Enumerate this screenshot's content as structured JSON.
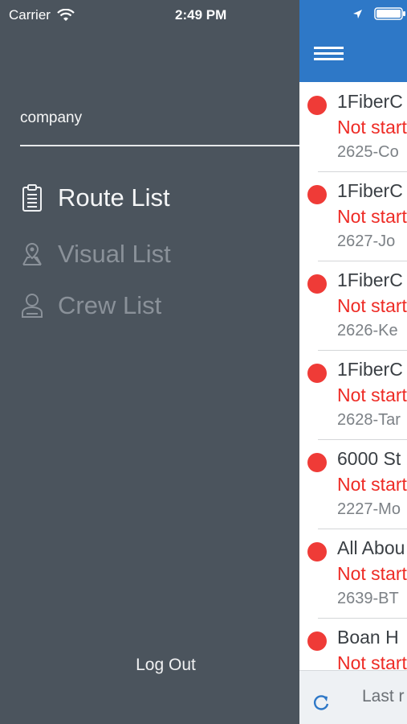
{
  "status": {
    "carrier": "Carrier",
    "time": "2:49 PM"
  },
  "drawer": {
    "company_label": "company",
    "menu": [
      {
        "label": "Route List",
        "icon": "clipboard-icon",
        "active": true
      },
      {
        "label": "Visual List",
        "icon": "map-pin-icon",
        "active": false
      },
      {
        "label": "Crew List",
        "icon": "person-icon",
        "active": false
      }
    ],
    "logout_label": "Log Out"
  },
  "main": {
    "rows": [
      {
        "title": "1FiberC",
        "status": "Not start",
        "sub": "2625-Co"
      },
      {
        "title": "1FiberC",
        "status": "Not start",
        "sub": "2627-Jo"
      },
      {
        "title": "1FiberC",
        "status": "Not start",
        "sub": "2626-Ke"
      },
      {
        "title": "1FiberC",
        "status": "Not start",
        "sub": "2628-Tar"
      },
      {
        "title": "6000 St",
        "status": "Not start",
        "sub": "2227-Mo"
      },
      {
        "title": "All Abou",
        "status": "Not start",
        "sub": "2639-BT"
      },
      {
        "title": "Boan H",
        "status": "Not start",
        "sub": ""
      }
    ],
    "footer_text": "Last r"
  },
  "colors": {
    "drawer_bg": "#4b545d",
    "nav_blue": "#2e78c7",
    "status_red": "#ee2b25"
  }
}
